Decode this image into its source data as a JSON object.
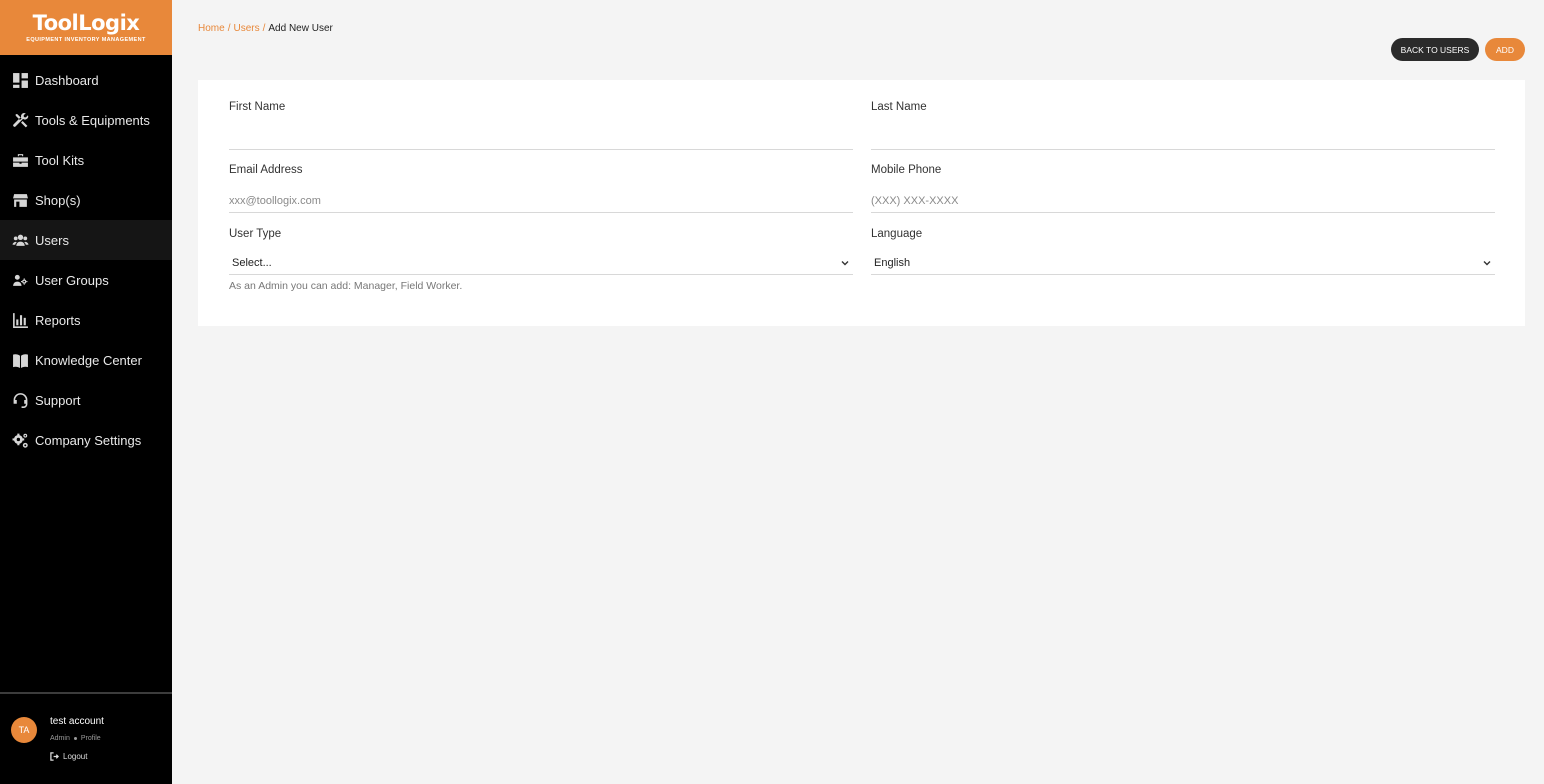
{
  "brand": {
    "title": "ToolLogix",
    "subtitle": "EQUIPMENT INVENTORY MANAGEMENT",
    "accent": "#e8883a"
  },
  "sidebar": {
    "items": [
      {
        "label": "Dashboard",
        "icon": "dashboard-icon"
      },
      {
        "label": "Tools & Equipments",
        "icon": "tools-icon"
      },
      {
        "label": "Tool Kits",
        "icon": "toolbox-icon"
      },
      {
        "label": "Shop(s)",
        "icon": "shop-icon"
      },
      {
        "label": "Users",
        "icon": "users-icon",
        "active": true
      },
      {
        "label": "User Groups",
        "icon": "user-groups-icon"
      },
      {
        "label": "Reports",
        "icon": "reports-icon"
      },
      {
        "label": "Knowledge Center",
        "icon": "book-icon"
      },
      {
        "label": "Support",
        "icon": "headset-icon"
      },
      {
        "label": "Company Settings",
        "icon": "gears-icon"
      }
    ],
    "user": {
      "initials": "TA",
      "name": "test account",
      "role": "Admin",
      "profile_label": "Profile",
      "logout_label": "Logout"
    }
  },
  "breadcrumb": {
    "home": "Home",
    "users": "Users",
    "current": "Add New User",
    "separator": "/"
  },
  "actions": {
    "back_label": "BACK TO USERS",
    "add_label": "ADD"
  },
  "form": {
    "first_name": {
      "label": "First Name",
      "value": ""
    },
    "last_name": {
      "label": "Last Name",
      "value": ""
    },
    "email": {
      "label": "Email Address",
      "placeholder": "xxx@toollogix.com"
    },
    "mobile": {
      "label": "Mobile Phone",
      "placeholder": "(XXX) XXX-XXXX"
    },
    "user_type": {
      "label": "User Type",
      "value": "Select...",
      "hint": "As an Admin you can add: Manager, Field Worker."
    },
    "language": {
      "label": "Language",
      "value": "English"
    }
  }
}
